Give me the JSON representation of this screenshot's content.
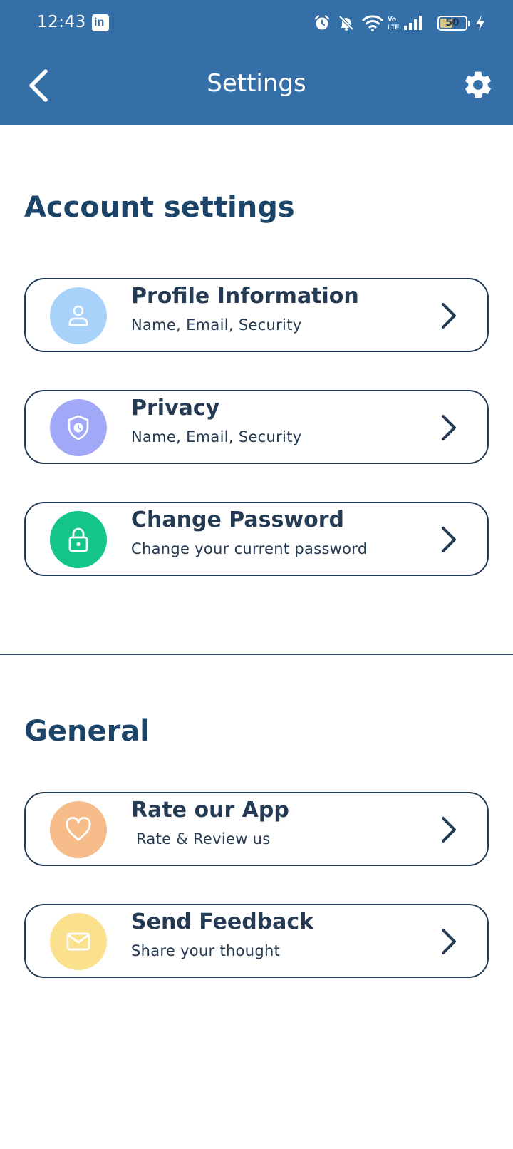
{
  "status_bar": {
    "time": "12:43",
    "battery_level": "50",
    "battery_fraction": 0.5
  },
  "header": {
    "title": "Settings",
    "background": "#356fa7"
  },
  "sections": [
    {
      "title": "Account settings",
      "items": [
        {
          "title": "Profile Information",
          "subtitle": "Name, Email, Security",
          "icon": "user-icon",
          "icon_bg": "#a9d2fb"
        },
        {
          "title": "Privacy",
          "subtitle": "Name, Email, Security",
          "icon": "shield-clock-icon",
          "icon_bg": "#a0a8f7"
        },
        {
          "title": "Change Password",
          "subtitle": "Change your current password",
          "icon": "lock-icon",
          "icon_bg": "#14c48b"
        }
      ]
    },
    {
      "title": "General",
      "items": [
        {
          "title": "Rate our App",
          "subtitle": " Rate & Review us",
          "icon": "heart-icon",
          "icon_bg": "#f6bc8a"
        },
        {
          "title": "Send Feedback",
          "subtitle": "Share your thought",
          "icon": "mail-icon",
          "icon_bg": "#fbe08e"
        }
      ]
    }
  ]
}
